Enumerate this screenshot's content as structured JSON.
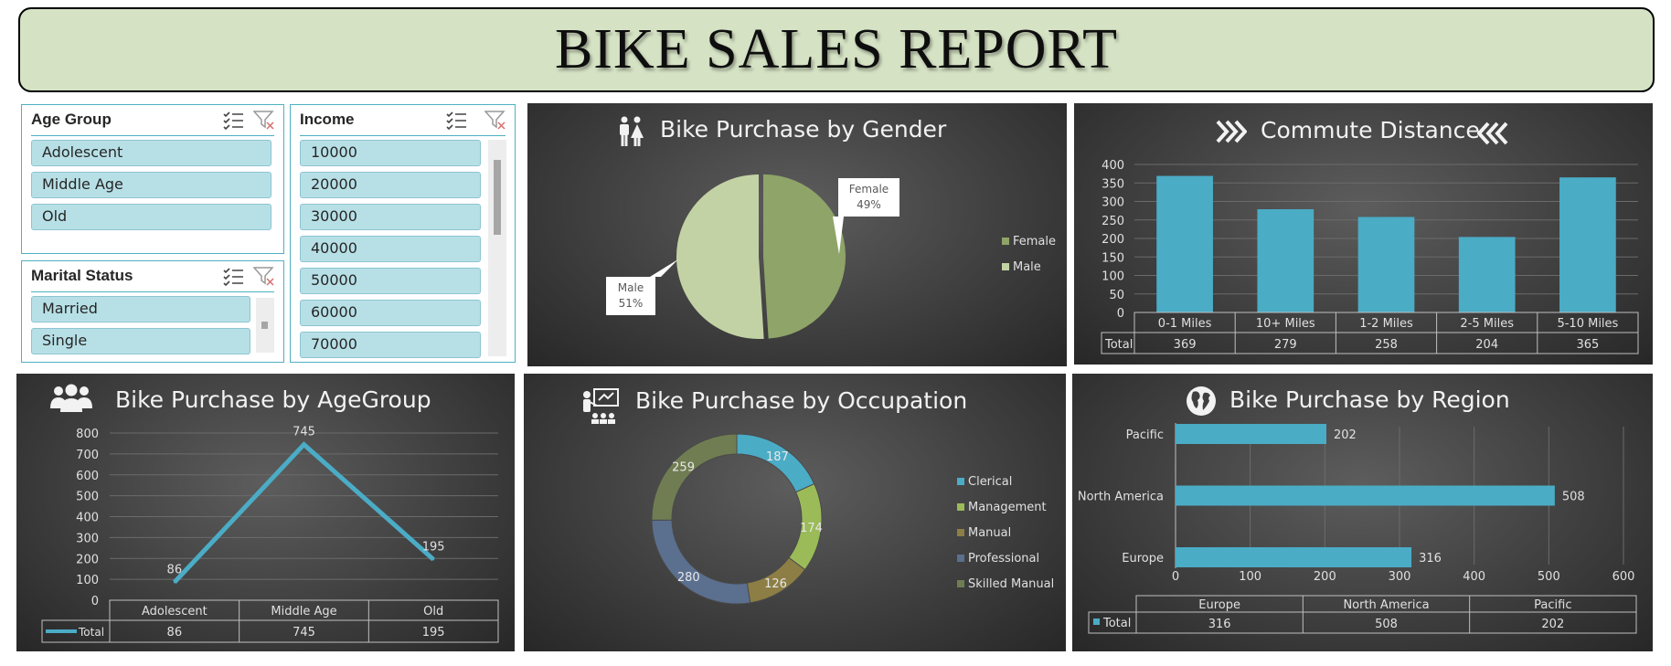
{
  "report_title": "BIKE SALES REPORT",
  "slicers": {
    "age_group": {
      "title": "Age Group",
      "items": [
        "Adolescent",
        "Middle Age",
        "Old"
      ]
    },
    "marital_status": {
      "title": "Marital Status",
      "items": [
        "Married",
        "Single"
      ]
    },
    "income": {
      "title": "Income",
      "items": [
        "10000",
        "20000",
        "30000",
        "40000",
        "50000",
        "60000",
        "70000"
      ]
    }
  },
  "colors": {
    "accent": "#4bacc6",
    "slicer_fill": "#b7e0e6",
    "title_band": "#d5e2c4",
    "panel_bg": "#404040"
  },
  "chart_data": [
    {
      "id": "gender",
      "type": "pie",
      "title": "Bike Purchase by Gender",
      "labels": [
        "Female",
        "Male"
      ],
      "values": [
        49,
        51
      ],
      "data_labels": [
        "Female\n49%",
        "Male\n51%"
      ],
      "colors": [
        "#8fa468",
        "#c3d2a4"
      ],
      "legend": "right"
    },
    {
      "id": "commute",
      "type": "bar",
      "title": "Commute Distance",
      "categories": [
        "0-1 Miles",
        "10+ Miles",
        "1-2 Miles",
        "2-5 Miles",
        "5-10 Miles"
      ],
      "series": [
        {
          "name": "Total",
          "values": [
            369,
            279,
            258,
            204,
            365
          ]
        }
      ],
      "ylim": [
        0,
        400
      ],
      "yticks": [
        "0",
        "50",
        "100",
        "150",
        "200",
        "250",
        "300",
        "350",
        "400"
      ],
      "grid": true,
      "data_table": true
    },
    {
      "id": "agegroup",
      "type": "line",
      "title": "Bike Purchase by AgeGroup",
      "categories": [
        "Adolescent",
        "Middle Age",
        "Old"
      ],
      "series": [
        {
          "name": "Total",
          "values": [
            86,
            745,
            195
          ]
        }
      ],
      "ylim": [
        0,
        800
      ],
      "yticks": [
        "0",
        "100",
        "200",
        "300",
        "400",
        "500",
        "600",
        "700",
        "800"
      ],
      "grid": true,
      "data_table": true
    },
    {
      "id": "occupation",
      "type": "pie",
      "title": "Bike Purchase by Occupation",
      "labels": [
        "Clerical",
        "Management",
        "Manual",
        "Professional",
        "Skilled Manual"
      ],
      "values": [
        187,
        174,
        126,
        280,
        259
      ],
      "colors": [
        "#4bacc6",
        "#9bbb59",
        "#8c7e44",
        "#5b6f8f",
        "#707d52"
      ],
      "donut": true,
      "legend": "right"
    },
    {
      "id": "region",
      "type": "bar",
      "orientation": "horizontal",
      "title": "Bike Purchase by Region",
      "categories": [
        "Europe",
        "North America",
        "Pacific"
      ],
      "series": [
        {
          "name": "Total",
          "values": [
            316,
            508,
            202
          ]
        }
      ],
      "xlim": [
        0,
        600
      ],
      "xticks": [
        "0",
        "100",
        "200",
        "300",
        "400",
        "500",
        "600"
      ],
      "grid": true,
      "data_table": true
    }
  ]
}
